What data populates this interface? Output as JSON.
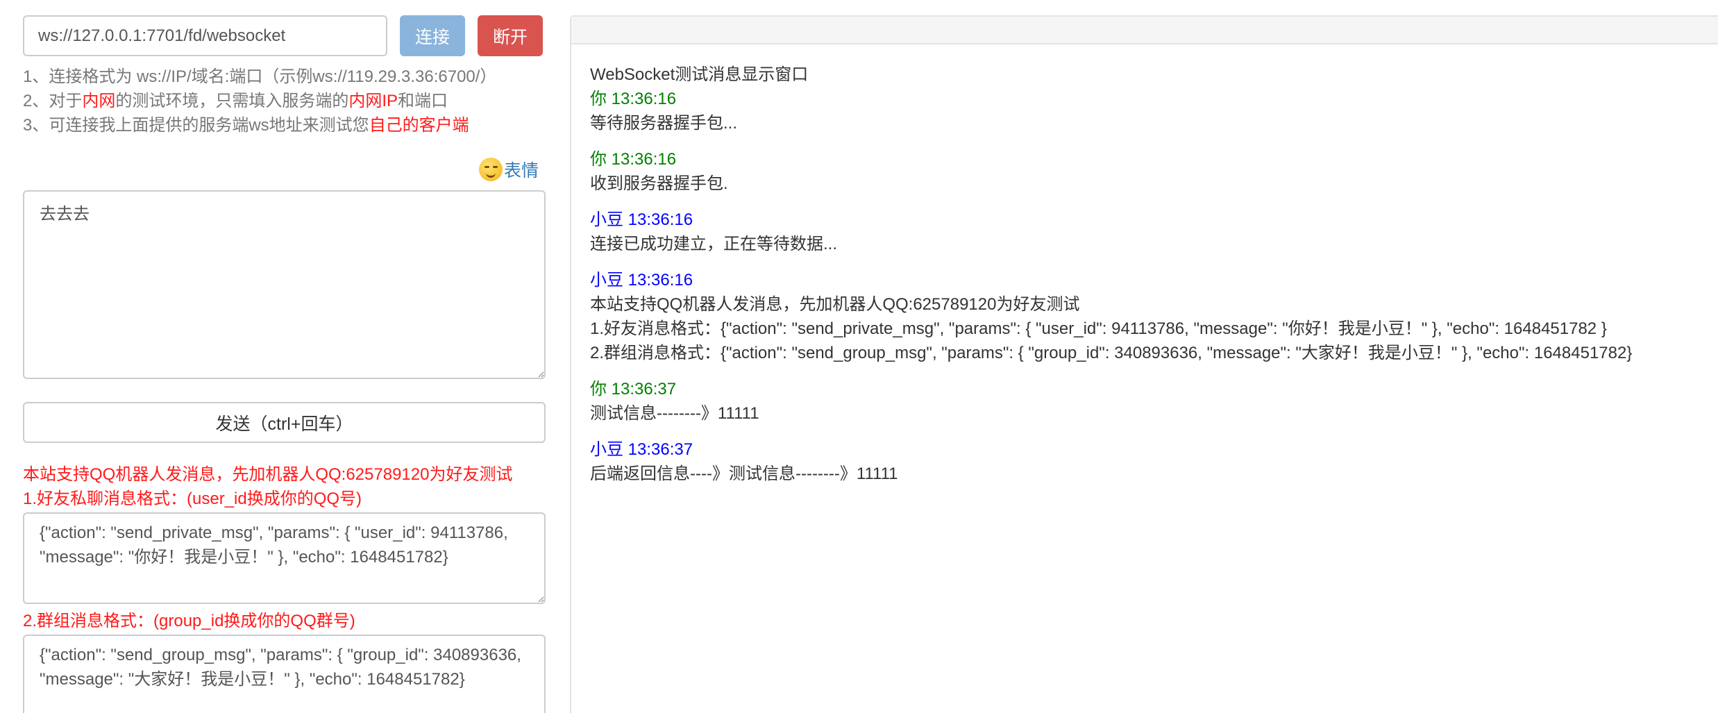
{
  "connection": {
    "url": "ws://127.0.0.1:7701/fd/websocket",
    "connect_label": "连接",
    "disconnect_label": "断开"
  },
  "tips": {
    "line1": "1、连接格式为 ws://IP/域名:端口（示例ws://119.29.3.36:6700/）",
    "line2_a": "2、对于",
    "line2_b": "内网",
    "line2_c": "的测试环境，只需填入服务端的",
    "line2_d": "内网IP",
    "line2_e": "和端口",
    "line3_a": "3、可连接我上面提供的服务端ws地址来测试您",
    "line3_b": "自己的客户端"
  },
  "emoji": {
    "label": "表情"
  },
  "message": {
    "value": "去去去"
  },
  "send": {
    "label": "发送（ctrl+回车）"
  },
  "qq": {
    "intro": "本站支持QQ机器人发消息，先加机器人QQ:625789120为好友测试",
    "private_label": "1.好友私聊消息格式：(user_id换成你的QQ号)",
    "private_value": "{\"action\": \"send_private_msg\", \"params\": { \"user_id\": 94113786, \"message\": \"你好！我是小豆！\" }, \"echo\": 1648451782}",
    "group_label": "2.群组消息格式：(group_id换成你的QQ群号)",
    "group_value": "{\"action\": \"send_group_msg\", \"params\": { \"group_id\": 340893636, \"message\": \"大家好！我是小豆！\" }, \"echo\": 1648451782}"
  },
  "log": {
    "title": "WebSocket测试消息显示窗口",
    "entries": [
      {
        "who": "你 13:36:16",
        "type": "you",
        "lines": [
          "等待服务器握手包..."
        ]
      },
      {
        "who": "你 13:36:16",
        "type": "you",
        "lines": [
          "收到服务器握手包."
        ]
      },
      {
        "who": "小豆 13:36:16",
        "type": "bot",
        "lines": [
          "连接已成功建立，正在等待数据..."
        ]
      },
      {
        "who": "小豆 13:36:16",
        "type": "bot",
        "lines": [
          "本站支持QQ机器人发消息，先加机器人QQ:625789120为好友测试",
          "1.好友消息格式：{\"action\": \"send_private_msg\", \"params\": { \"user_id\": 94113786, \"message\": \"你好！我是小豆！\" }, \"echo\": 1648451782 }",
          "2.群组消息格式：{\"action\": \"send_group_msg\", \"params\": { \"group_id\": 340893636, \"message\": \"大家好！我是小豆！\" }, \"echo\": 1648451782}"
        ]
      },
      {
        "who": "你 13:36:37",
        "type": "you",
        "lines": [
          "测试信息--------》11111"
        ]
      },
      {
        "who": "小豆 13:36:37",
        "type": "bot",
        "lines": [
          "后端返回信息----》测试信息--------》11111"
        ]
      }
    ]
  },
  "colors": {
    "you": "#008000",
    "bot": "#0000ff",
    "highlight": "#ff1a1a",
    "connect": "#8ab4db",
    "disconnect": "#d9534f"
  }
}
